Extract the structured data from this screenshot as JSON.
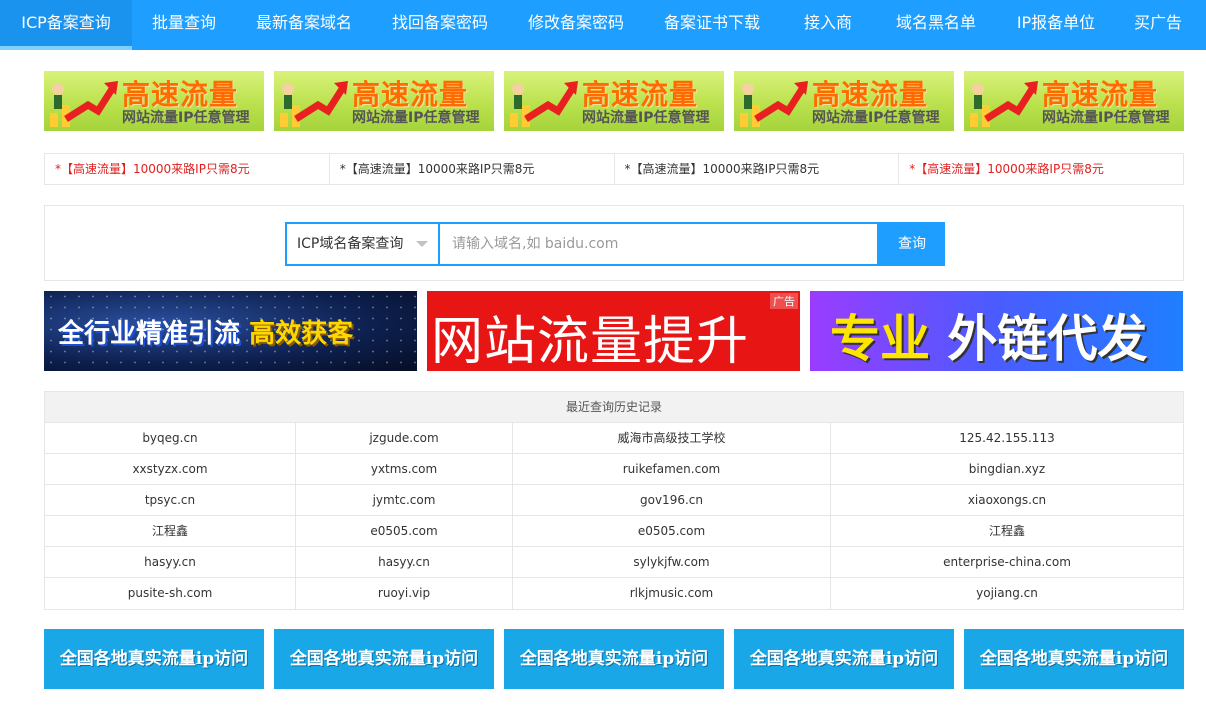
{
  "nav": {
    "items": [
      {
        "label": "ICP备案查询"
      },
      {
        "label": "批量查询"
      },
      {
        "label": "最新备案域名"
      },
      {
        "label": "找回备案密码"
      },
      {
        "label": "修改备案密码"
      },
      {
        "label": "备案证书下载"
      },
      {
        "label": "接入商"
      },
      {
        "label": "域名黑名单"
      },
      {
        "label": "IP报备单位"
      },
      {
        "label": "买广告"
      }
    ],
    "active_index": 0
  },
  "top_ads": [
    {
      "title": "高速流量",
      "subtitle": "网站流量IP任意管理"
    },
    {
      "title": "高速流量",
      "subtitle": "网站流量IP任意管理"
    },
    {
      "title": "高速流量",
      "subtitle": "网站流量IP任意管理"
    },
    {
      "title": "高速流量",
      "subtitle": "网站流量IP任意管理"
    },
    {
      "title": "高速流量",
      "subtitle": "网站流量IP任意管理"
    }
  ],
  "text_ads": [
    {
      "star": "*",
      "text": "【高速流量】10000来路IP只需8元",
      "color": "red"
    },
    {
      "star": "*",
      "text": "【高速流量】10000来路IP只需8元",
      "color": "black"
    },
    {
      "star": "*",
      "text": "【高速流量】10000来路IP只需8元",
      "color": "black"
    },
    {
      "star": "*",
      "text": "【高速流量】10000来路IP只需8元",
      "color": "red"
    }
  ],
  "search": {
    "select_value": "ICP域名备案查询",
    "placeholder": "请输入域名,如 baidu.com",
    "button_label": "查询"
  },
  "big_ads": {
    "ad1_white": "全行业精准引流",
    "ad1_yellow": "高效获客",
    "ad2_text": "网站流量提升",
    "ad2_mark": "广告",
    "ad3_yellow": "专业",
    "ad3_white": "外链代发"
  },
  "history": {
    "title": "最近查询历史记录",
    "rows": [
      [
        "byqeg.cn",
        "jzgude.com",
        "威海市高级技工学校",
        "125.42.155.113"
      ],
      [
        "xxstyzx.com",
        "yxtms.com",
        "ruikefamen.com",
        "bingdian.xyz"
      ],
      [
        "tpsyc.cn",
        "jymtc.com",
        "gov196.cn",
        "xiaoxongs.cn"
      ],
      [
        "江程鑫",
        "e0505.com",
        "e0505.com",
        "江程鑫"
      ],
      [
        "hasyy.cn",
        "hasyy.cn",
        "sylykjfw.com",
        "enterprise-china.com"
      ],
      [
        "pusite-sh.com",
        "ruoyi.vip",
        "rlkjmusic.com",
        "yojiang.cn"
      ]
    ]
  },
  "bottom_buttons": [
    {
      "label": "全国各地真实流量ip访问"
    },
    {
      "label": "全国各地真实流量ip访问"
    },
    {
      "label": "全国各地真实流量ip访问"
    },
    {
      "label": "全国各地真实流量ip访问"
    },
    {
      "label": "全国各地真实流量ip访问"
    }
  ],
  "colors": {
    "brand_blue": "#1e9fff",
    "ad_red": "#e02020",
    "bottom_button": "#1aa7e8"
  }
}
